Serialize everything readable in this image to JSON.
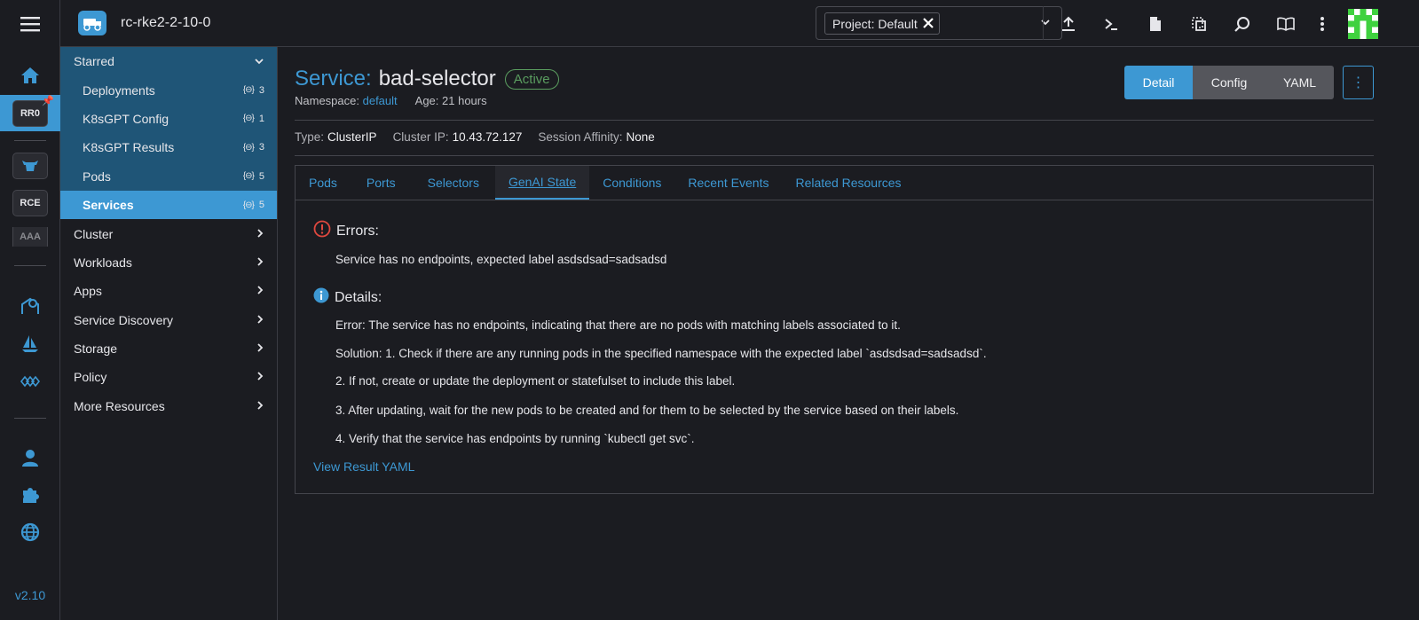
{
  "rail": {
    "clusters": [
      "RR0",
      "RCE",
      "AAA"
    ],
    "version": "v2.10"
  },
  "header": {
    "cluster_name": "rc-rke2-2-10-0",
    "project_filter": "Project: Default"
  },
  "sidenav": {
    "starred_label": "Starred",
    "starred_items": [
      {
        "label": "Deployments",
        "count": "3"
      },
      {
        "label": "K8sGPT Config",
        "count": "1"
      },
      {
        "label": "K8sGPT Results",
        "count": "3"
      },
      {
        "label": "Pods",
        "count": "5"
      },
      {
        "label": "Services",
        "count": "5"
      }
    ],
    "groups": [
      "Cluster",
      "Workloads",
      "Apps",
      "Service Discovery",
      "Storage",
      "Policy",
      "More Resources"
    ]
  },
  "resource": {
    "kind": "Service:",
    "name": "bad-selector",
    "state": "Active",
    "namespace_label": "Namespace:",
    "namespace": "default",
    "age": "Age: 21 hours"
  },
  "view_modes": [
    "Detail",
    "Config",
    "YAML"
  ],
  "info": {
    "type_label": "Type:",
    "type": "ClusterIP",
    "cluster_ip_label": "Cluster IP:",
    "cluster_ip": "10.43.72.127",
    "affinity_label": "Session Affinity:",
    "affinity": "None"
  },
  "tabs": [
    "Pods",
    "Ports",
    "Selectors",
    "GenAI State",
    "Conditions",
    "Recent Events",
    "Related Resources"
  ],
  "genai": {
    "errors_title": "Errors:",
    "error_text": "Service has no endpoints, expected label asdsdsad=sadsadsd",
    "details_title": "Details:",
    "details": [
      "Error: The service has no endpoints, indicating that there are no pods with matching labels associated to it.",
      "Solution: 1. Check if there are any running pods in the specified namespace with the expected label `asdsdsad=sadsadsd`.",
      "2. If not, create or update the deployment or statefulset to include this label.",
      "3. After updating, wait for the new pods to be created and for them to be selected by the service based on their labels.",
      "4. Verify that the service has endpoints by running `kubectl get svc`."
    ],
    "view_yaml": "View Result YAML"
  },
  "colors": {
    "accent": "#3d98d3",
    "active_green": "#5a9d5f",
    "error_red": "#e0483f"
  }
}
